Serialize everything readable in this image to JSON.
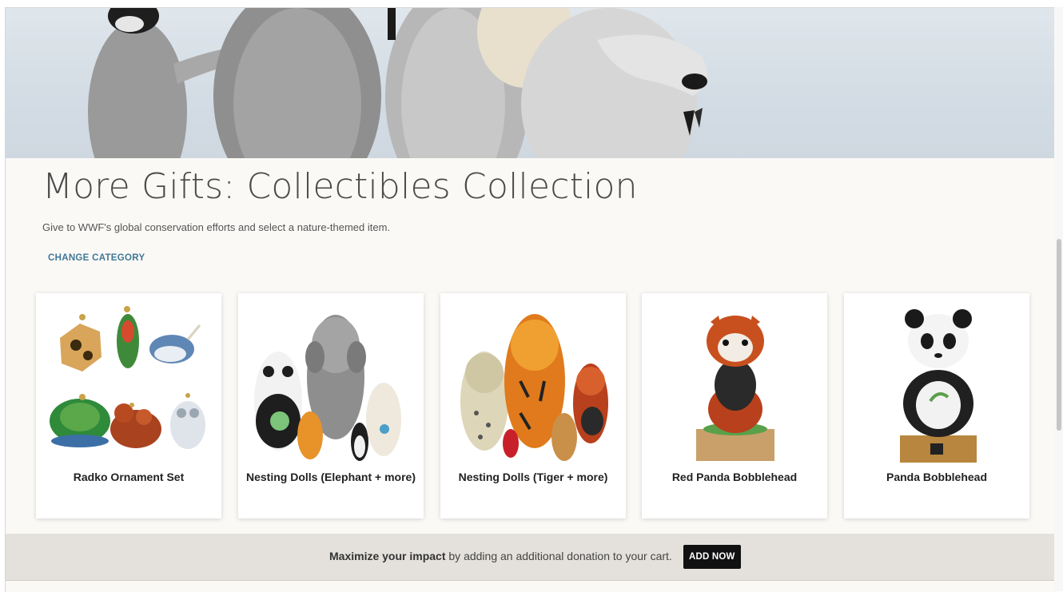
{
  "page": {
    "title": "More Gifts: Collectibles Collection",
    "subtitle": "Give to WWF's global conservation efforts and select a nature-themed item.",
    "change_category": "CHANGE CATEGORY"
  },
  "products": [
    {
      "name": "Radko Ornament Set"
    },
    {
      "name": "Nesting Dolls (Elephant + more)"
    },
    {
      "name": "Nesting Dolls (Tiger + more)"
    },
    {
      "name": "Red Panda Bobblehead"
    },
    {
      "name": "Panda Bobblehead"
    }
  ],
  "banner": {
    "bold": "Maximize your impact",
    "text": " by adding an additional donation to your cart.",
    "button": "ADD NOW"
  },
  "colors": {
    "accent_link": "#3f7898",
    "button_bg": "#111111",
    "banner_bg": "#e4e1dc",
    "page_bg": "#fbf9f6"
  },
  "icons": {
    "hero": "penguin-chicks-photo"
  }
}
